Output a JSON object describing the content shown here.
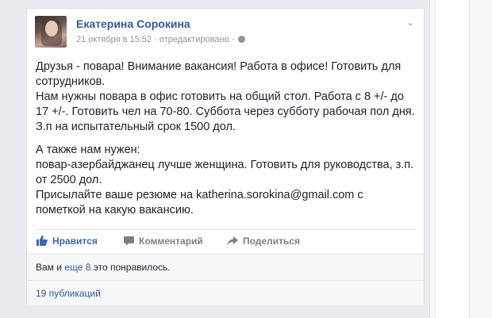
{
  "post": {
    "author": "Екатерина Сорокина",
    "timestamp": "21 октября в 15:52",
    "edited": "· отредактировано ·",
    "paragraphs": [
      "Друзья - повара! Внимание вакансия! Работа в офисе! Готовить для сотрудников.",
      "Нам нужны повара в офис готовить на общий стол. Работа с 8 +/- до 17 +/-. Готовить чел на 70-80. Суббота через субботу рабочая пол дня. З.п на испытательный срок 1500 дол.",
      "А также нам нужен:",
      "повар-азербайджанец лучше женщина. Готовить для руководства, з.п. от 2500 дол.",
      "Присылайте ваше резюме на katherina.sorokina@gmail.com с пометкой на какую вакансию."
    ]
  },
  "actions": {
    "like": "Нравится",
    "comment": "Комментарий",
    "share": "Поделиться"
  },
  "likes": {
    "prefix": "Вам и ",
    "link": "еще 8",
    "suffix": " это понравилось."
  },
  "shares": {
    "label": "19 публикаций"
  },
  "icons": {
    "like": "thumbs-up-icon",
    "comment": "comment-icon",
    "share": "share-arrow-icon",
    "privacy": "globe-icon",
    "menu": "chevron-down-icon"
  },
  "colors": {
    "link": "#365899",
    "like_active": "#4267b2",
    "text": "#1d2129",
    "muted": "#90949c"
  }
}
